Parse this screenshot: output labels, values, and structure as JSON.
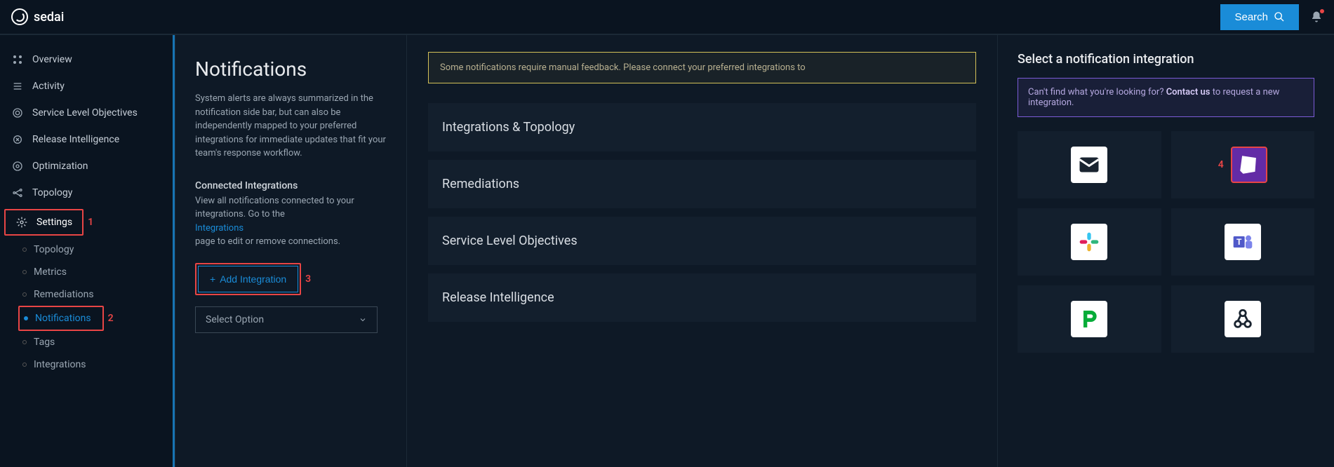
{
  "brand": "sedai",
  "topbar": {
    "search": "Search"
  },
  "sidebar": {
    "overview": "Overview",
    "activity": "Activity",
    "slo": "Service Level Objectives",
    "release": "Release Intelligence",
    "optimization": "Optimization",
    "topology": "Topology",
    "settings": "Settings",
    "sub": {
      "topology": "Topology",
      "metrics": "Metrics",
      "remediations": "Remediations",
      "notifications": "Notifications",
      "tags": "Tags",
      "integrations": "Integrations"
    }
  },
  "steps": {
    "s1": "1",
    "s2": "2",
    "s3": "3",
    "s4": "4"
  },
  "panel": {
    "title": "Notifications",
    "desc": "System alerts are always summarized in the notification side bar, but can also be independently mapped to your preferred integrations for immediate updates that fit your team's response workflow.",
    "connected_head": "Connected Integrations",
    "connected_desc1": "View all notifications connected to your integrations. Go to the",
    "connected_link": "Integrations",
    "connected_desc2": "page to edit or remove connections.",
    "add": "Add Integration",
    "select_placeholder": "Select Option"
  },
  "mid": {
    "warn": "Some notifications require manual feedback. Please connect your preferred integrations to",
    "sections": {
      "integ": "Integrations & Topology",
      "rem": "Remediations",
      "slo": "Service Level Objectives",
      "rel": "Release Intelligence"
    }
  },
  "right": {
    "title": "Select a notification integration",
    "banner_pre": "Can't find what you're looking for? ",
    "banner_cu": "Contact us",
    "banner_post": " to request a new integration.",
    "tiles": {
      "email": "Email",
      "datadog": "Datadog",
      "slack": "Slack",
      "teams": "Microsoft Teams",
      "pagerduty": "PagerDuty",
      "webhook": "Webhook"
    }
  }
}
